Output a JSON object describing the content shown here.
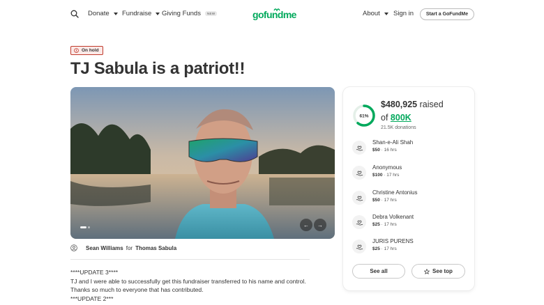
{
  "header": {
    "nav": [
      {
        "label": "Donate",
        "has_caret": true
      },
      {
        "label": "Fundraise",
        "has_caret": true
      },
      {
        "label": "Giving Funds",
        "badge": "NEW"
      }
    ],
    "logo_text": "gofundme",
    "right": [
      {
        "label": "About",
        "has_caret": true
      },
      {
        "label": "Sign in"
      }
    ],
    "start_button": "Start a GoFundMe"
  },
  "status_badge": "On hold",
  "title": "TJ Sabula is a patriot!!",
  "organizer": {
    "name": "Sean Williams",
    "for_text": "for",
    "beneficiary": "Thomas Sabula"
  },
  "story": [
    "****UPDATE 3****",
    "TJ and I were able to successfully get this fundraiser transferred to his name and control.",
    "Thanks so much to everyone that has contributed.",
    "***UPDATE 2***"
  ],
  "panel": {
    "progress_label": "61%",
    "progress_fraction": 0.61,
    "raised_amount": "$480,925",
    "raised_word": "raised",
    "of_word": "of",
    "goal": "800K",
    "donation_count": "21.5K donations",
    "donors": [
      {
        "name": "Shan-e-Ali Shah",
        "amount": "$50",
        "time": "16 hrs"
      },
      {
        "name": "Anonymous",
        "amount": "$100",
        "time": "17 hrs"
      },
      {
        "name": "Christine Antonius",
        "amount": "$50",
        "time": "17 hrs"
      },
      {
        "name": "Debra Volkenant",
        "amount": "$25",
        "time": "17 hrs"
      },
      {
        "name": "JURIS PURENS",
        "amount": "$25",
        "time": "17 hrs"
      }
    ],
    "see_all": "See all",
    "see_top": "See top"
  },
  "colors": {
    "brand_green": "#02a95c",
    "hold_red": "#c0392b"
  }
}
